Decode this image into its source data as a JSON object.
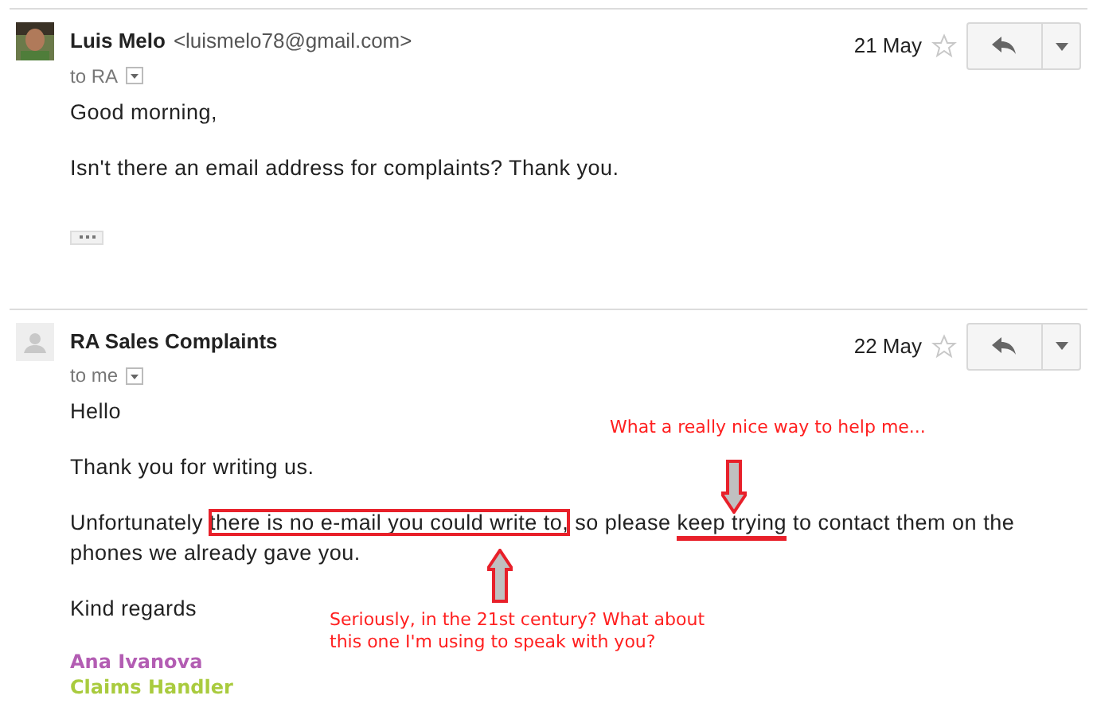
{
  "messages": [
    {
      "sender": "Luis Melo",
      "email": "<luismelo78@gmail.com>",
      "avatar": {
        "kind": "picture"
      },
      "recipient": "to RA",
      "date": "21 May",
      "starred": false,
      "trimmed_content": true,
      "paragraphs": [
        [
          {
            "text": "Good morning,"
          }
        ],
        [
          {
            "text": "Isn't there an email address for complaints? Thank you."
          }
        ]
      ]
    },
    {
      "sender": "RA Sales Complaints",
      "avatar": {
        "kind": "silhouette"
      },
      "recipient": "to me",
      "date": "22 May",
      "starred": false,
      "paragraphs": [
        [
          {
            "text": "Hello"
          }
        ],
        [
          {
            "text": "Thank you for  writing us."
          }
        ],
        [
          {
            "text": "Unfortunately "
          },
          {
            "kind": "boxed",
            "text": "there is no e-mail you could write to,"
          },
          {
            "text": " so please "
          },
          {
            "kind": "underlined",
            "text": "keep trying"
          },
          {
            "text": " to contact them on the phones we already gave you."
          }
        ],
        [
          {
            "text": "Kind regards"
          }
        ]
      ],
      "signature": [
        {
          "text": "Ana Ivanova",
          "color": "#b35db3"
        },
        {
          "text": "Claims Handler",
          "color": "#a9cb3e"
        }
      ]
    }
  ],
  "annotations": [
    {
      "kind": "note",
      "text": "What a really nice way to help me..."
    },
    {
      "kind": "arrow_down"
    },
    {
      "kind": "arrow_up"
    },
    {
      "kind": "note",
      "text": "Seriously, in the 21st century? What about this one I'm using to speak with you?"
    }
  ]
}
